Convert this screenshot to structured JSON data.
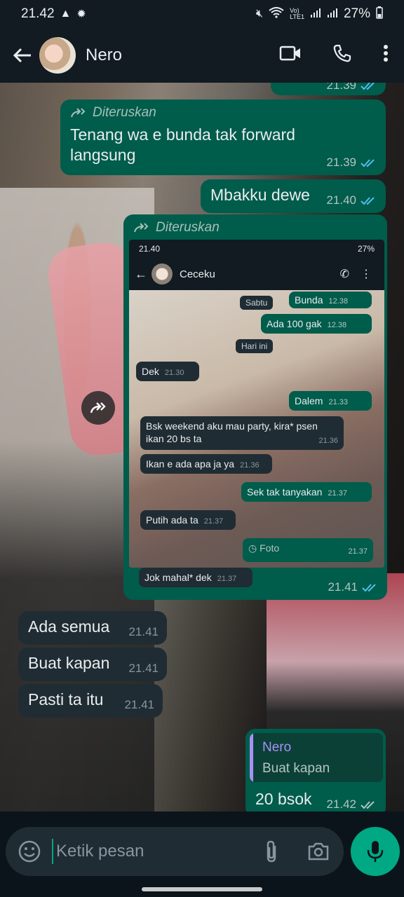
{
  "status_bar": {
    "time": "21.42",
    "battery": "27%",
    "net": "Vo)\nLTE1"
  },
  "header": {
    "contact_name": "Nero"
  },
  "messages": {
    "forward_label": "Diteruskan",
    "m1": {
      "text": "Tenang wa e bunda tak forward langsung",
      "time": "21.39"
    },
    "m0": {
      "time": "21.39"
    },
    "m2": {
      "text": "Mbakku dewe",
      "time": "21.40"
    },
    "m3": {
      "time": "21.41"
    },
    "m4": {
      "text": "Ada semua",
      "time": "21.41"
    },
    "m5": {
      "text": "Buat kapan",
      "time": "21.41"
    },
    "m6": {
      "text": "Pasti ta itu",
      "time": "21.41"
    },
    "m7": {
      "quote_name": "Nero",
      "quote_text": "Buat kapan",
      "text": "20 bsok",
      "time": "21.42"
    }
  },
  "shot": {
    "time": "21.40",
    "battery": "27%",
    "contact": "Ceceku",
    "chips": {
      "sabtu": "Sabtu",
      "hari_ini": "Hari ini"
    },
    "b1": {
      "text": "Bunda",
      "time": "12.38"
    },
    "b2": {
      "text": "Ada 100 gak",
      "time": "12.38"
    },
    "b3": {
      "text": "Dek",
      "time": "21.30"
    },
    "b4": {
      "text": "Dalem",
      "time": "21.33"
    },
    "b5": {
      "text": "Bsk weekend aku mau party, kira* psen ikan 20 bs ta",
      "time": "21.36"
    },
    "b6": {
      "text": "Ikan e ada apa ja ya",
      "time": "21.36"
    },
    "b7": {
      "text": "Sek tak tanyakan",
      "time": "21.37"
    },
    "b8": {
      "text": "Putih ada ta",
      "time": "21.37"
    },
    "b9": {
      "text": "Foto",
      "time": "21.37"
    },
    "b10": {
      "text": "Jok mahal* dek",
      "time": "21.37"
    }
  },
  "composer": {
    "placeholder": "Ketik pesan"
  },
  "colors": {
    "out_bubble": "#005c4b",
    "in_bubble": "#202c33",
    "accent": "#00a884",
    "read_ticks": "#53bdeb"
  }
}
